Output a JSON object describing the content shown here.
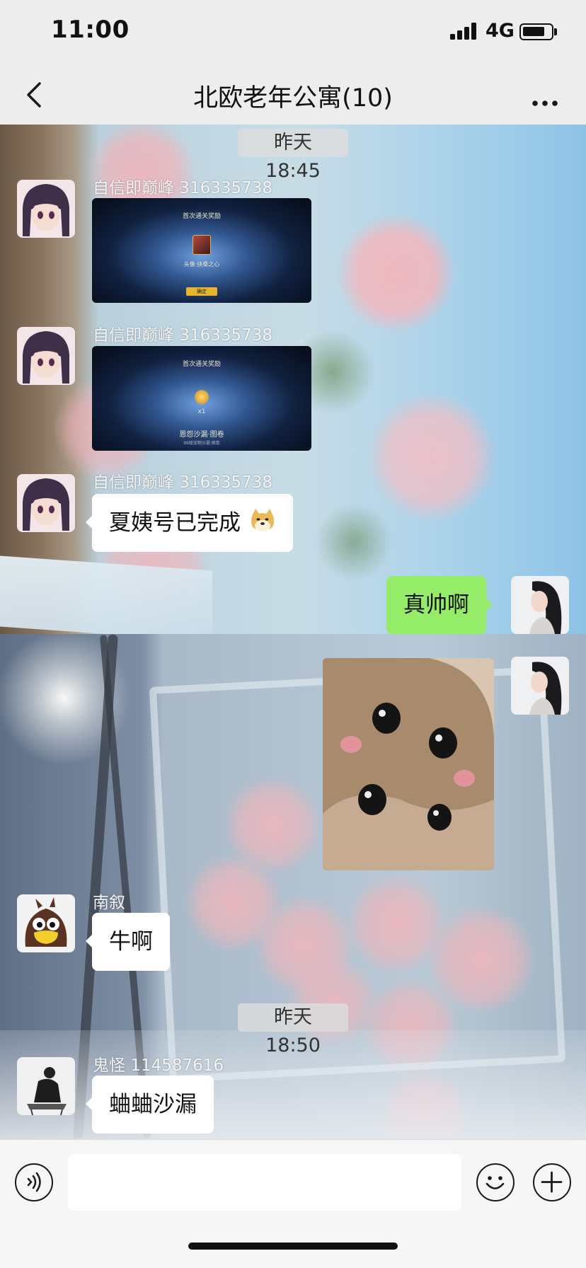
{
  "status_bar": {
    "time": "11:00",
    "network": "4G"
  },
  "header": {
    "title": "北欧老年公寓(10)"
  },
  "messages": {
    "timestamp_1": "昨天 18:45",
    "timestamp_2": "昨天 18:50",
    "msg_1": {
      "sender": "自信即巅峰 316335738",
      "type": "image",
      "image_title": "首次通关奖励",
      "image_caption": "头像·扶桑之心",
      "image_button": "确定"
    },
    "msg_2": {
      "sender": "自信即巅峰 316335738",
      "type": "image",
      "image_title": "首次通关奖励",
      "image_count": "x1",
      "image_caption": "恩怨沙漏·图卷",
      "image_subcaption": "99级宠物沙漏·图卷"
    },
    "msg_3": {
      "sender": "自信即巅峰 316335738",
      "type": "text",
      "text": "夏姨号已完成",
      "emoji": "doge-emoji"
    },
    "msg_4": {
      "sender": "me",
      "type": "text",
      "text": "真帅啊"
    },
    "msg_5": {
      "sender": "me",
      "type": "image",
      "image": "kitten-sticker"
    },
    "msg_6": {
      "sender": "南叙",
      "type": "text",
      "text": "牛啊"
    },
    "msg_7": {
      "sender": "鬼怪 114587616",
      "type": "text",
      "text": "蛐蛐沙漏"
    }
  },
  "input": {
    "placeholder": ""
  },
  "icons": {
    "back": "chevron-left-icon",
    "more": "more-dots-icon",
    "voice": "voice-icon",
    "emoji": "smiley-icon",
    "plus": "plus-icon"
  },
  "colors": {
    "outgoing_bubble": "#95ec69",
    "incoming_bubble": "#ffffff",
    "app_bar": "#ededed"
  }
}
